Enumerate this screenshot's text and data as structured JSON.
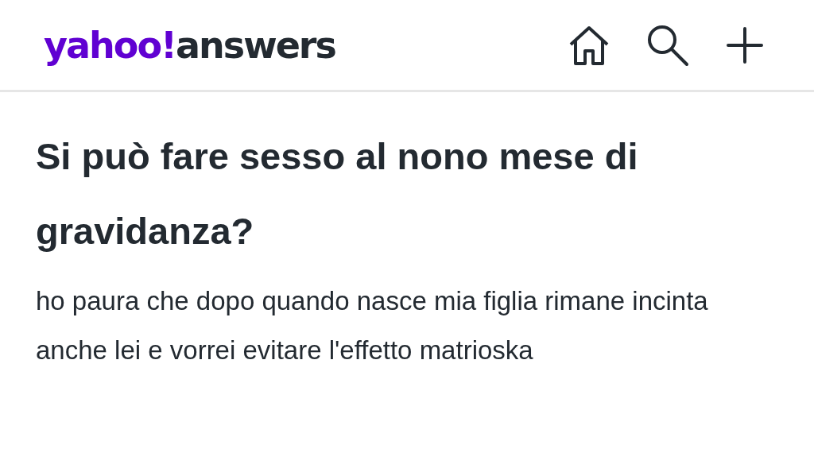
{
  "header": {
    "logo": {
      "brand": "yahoo!",
      "product": "answers"
    }
  },
  "question": {
    "title": "Si può fare sesso al nono mese di gravidanza?",
    "details": "ho paura che dopo quando nasce mia figlia rimane incinta anche lei e vorrei evitare l'effetto matrioska"
  }
}
